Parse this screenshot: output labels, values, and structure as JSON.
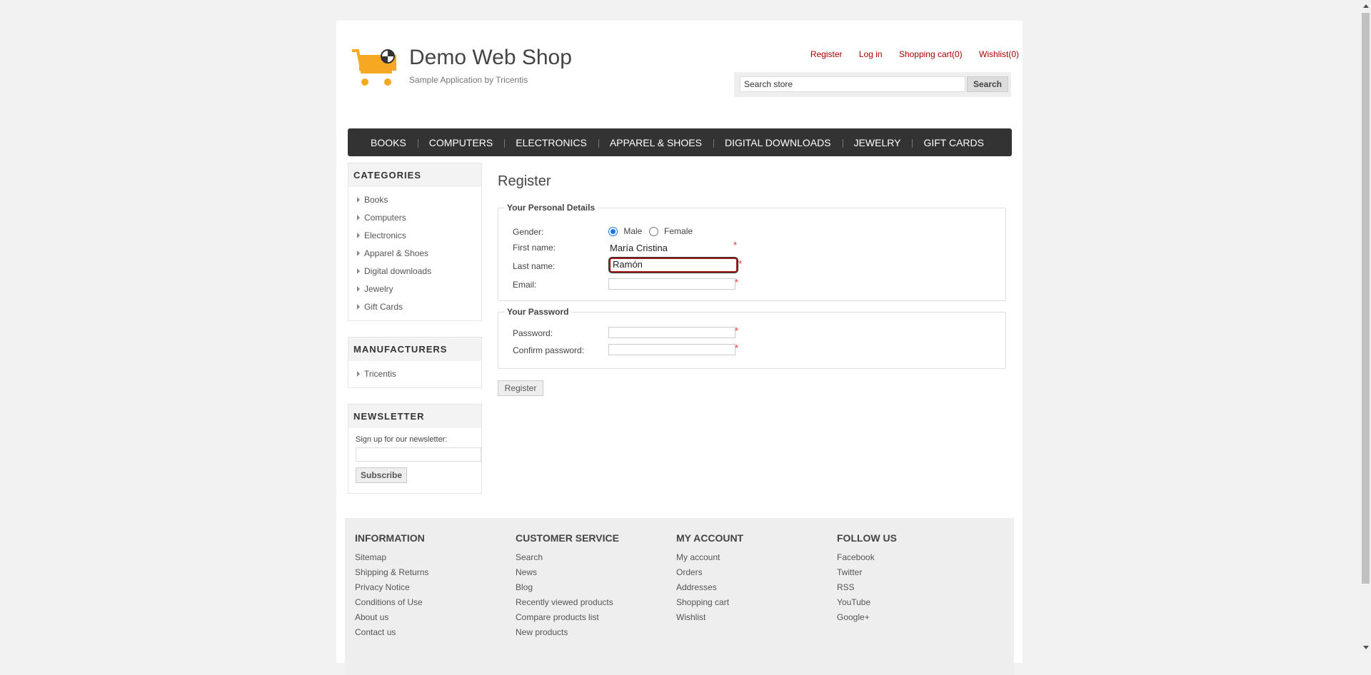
{
  "header": {
    "store_name": "Demo Web Shop",
    "tagline": "Sample Application by Tricentis",
    "links": [
      "Register",
      "Log in",
      "Shopping cart(0)",
      "Wishlist(0)"
    ],
    "search_value": "Search store",
    "search_button": "Search"
  },
  "menu": [
    "BOOKS",
    "COMPUTERS",
    "ELECTRONICS",
    "APPAREL & SHOES",
    "DIGITAL DOWNLOADS",
    "JEWELRY",
    "GIFT CARDS"
  ],
  "sidebar": {
    "categories_title": "CATEGORIES",
    "categories": [
      "Books",
      "Computers",
      "Electronics",
      "Apparel & Shoes",
      "Digital downloads",
      "Jewelry",
      "Gift Cards"
    ],
    "manufacturers_title": "MANUFACTURERS",
    "manufacturers": [
      "Tricentis"
    ],
    "newsletter_title": "NEWSLETTER",
    "newsletter_label": "Sign up for our newsletter:",
    "subscribe": "Subscribe"
  },
  "main": {
    "title": "Register",
    "personal_legend": "Your Personal Details",
    "gender_label": "Gender:",
    "male": "Male",
    "female": "Female",
    "first_name_label": "First name:",
    "first_name_value": "María Cristina",
    "last_name_label": "Last name:",
    "last_name_value": "Ramón",
    "email_label": "Email:",
    "password_legend": "Your Password",
    "password_label": "Password:",
    "confirm_label": "Confirm password:",
    "register_button": "Register",
    "required_mark": "*"
  },
  "footer": {
    "information_title": "INFORMATION",
    "information": [
      "Sitemap",
      "Shipping & Returns",
      "Privacy Notice",
      "Conditions of Use",
      "About us",
      "Contact us"
    ],
    "customer_title": "CUSTOMER SERVICE",
    "customer": [
      "Search",
      "News",
      "Blog",
      "Recently viewed products",
      "Compare products list",
      "New products"
    ],
    "account_title": "MY ACCOUNT",
    "account": [
      "My account",
      "Orders",
      "Addresses",
      "Shopping cart",
      "Wishlist"
    ],
    "follow_title": "FOLLOW US",
    "follow": [
      "Facebook",
      "Twitter",
      "RSS",
      "YouTube",
      "Google+"
    ]
  }
}
